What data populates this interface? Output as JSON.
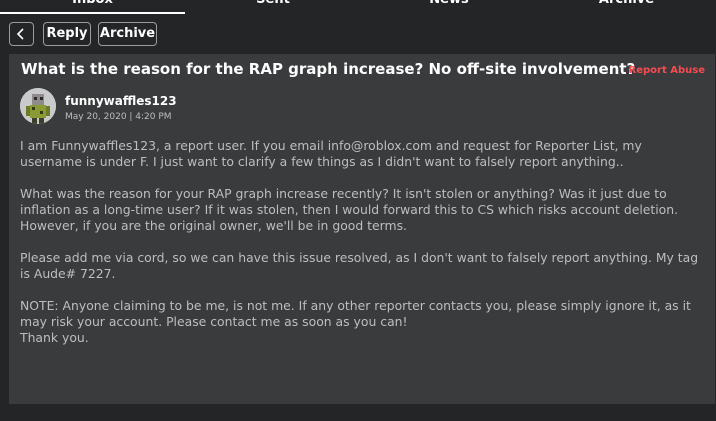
{
  "tabs": [
    {
      "label": "Inbox"
    },
    {
      "label": "Sent"
    },
    {
      "label": "News"
    },
    {
      "label": "Archive"
    }
  ],
  "toolbar": {
    "back_icon": "chevron-left-icon",
    "reply_label": "Reply",
    "archive_label": "Archive"
  },
  "message": {
    "subject": "What is the reason for the RAP graph increase? No off-site involvement?",
    "report_label": "Report Abuse",
    "sender": "funnywaffles123",
    "date": "May 20, 2020 | 4:20 PM",
    "paragraphs": [
      "I am Funnywaffles123, a report user. If you email info@roblox.com and request for Reporter List, my\nusername is under F. I just want to clarify a few things as I didn't want to falsely report anything..",
      "What was the reason for your RAP graph increase recently? It isn't stolen or anything? Was it just due to\ninflation as a long-time user? If it was stolen, then I would forward this to CS which risks account deletion.\nHowever, if you are the original owner, we'll be in good terms.",
      "Please add me via cord, so we can have this issue resolved, as I don't want to falsely report anything. My tag\nis Aude# 7227.",
      "NOTE: Anyone claiming to be me, is not me. If any other reporter contacts you, please simply ignore it, as it\nmay risk your account. Please contact me as soon as you can!\nThank you."
    ]
  },
  "colors": {
    "background": "#232527",
    "card": "#393b3d",
    "report_abuse": "#f74b52"
  }
}
